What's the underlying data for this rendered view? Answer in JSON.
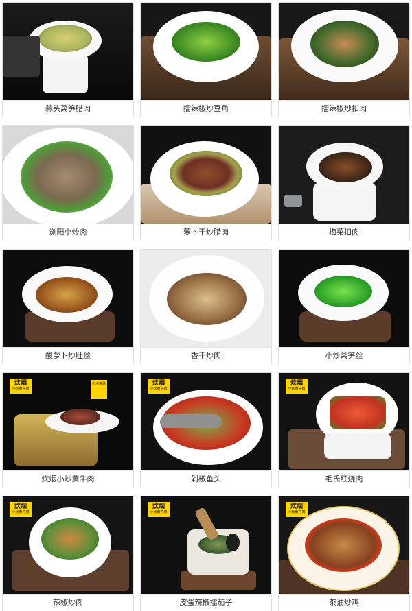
{
  "dishes": [
    {
      "name": "蒜头莴笋腊肉",
      "badge": ""
    },
    {
      "name": "擂辣椒炒豆角",
      "badge": ""
    },
    {
      "name": "擂辣椒炒扣肉",
      "badge": ""
    },
    {
      "name": "浏阳小炒肉",
      "badge": ""
    },
    {
      "name": "萝卜干炒腊肉",
      "badge": ""
    },
    {
      "name": "梅菜扣肉",
      "badge": ""
    },
    {
      "name": "酸萝卜炒肚丝",
      "badge": ""
    },
    {
      "name": "香干炒肉",
      "badge": ""
    },
    {
      "name": "小炒莴笋丝",
      "badge": ""
    },
    {
      "name": "炊烟小炒黄牛肉",
      "badge": "炊烟",
      "badge_sub": "小炒黄牛肉"
    },
    {
      "name": "剁椒鱼头",
      "badge": "炊烟",
      "badge_sub": "小炒黄牛肉"
    },
    {
      "name": "毛氏红烧肉",
      "badge": "炊烟",
      "badge_sub": "小炒黄牛肉"
    },
    {
      "name": "辣椒炒肉",
      "badge": "炊烟",
      "badge_sub": "小炒黄牛肉"
    },
    {
      "name": "皮蛋辣椒擂茄子",
      "badge": "炊烟",
      "badge_sub": "小炒黄牛肉"
    },
    {
      "name": "茶油炒鸡",
      "badge": "炊烟",
      "badge_sub": "小炒黄牛肉"
    }
  ],
  "sticker_text": "必点菜品"
}
